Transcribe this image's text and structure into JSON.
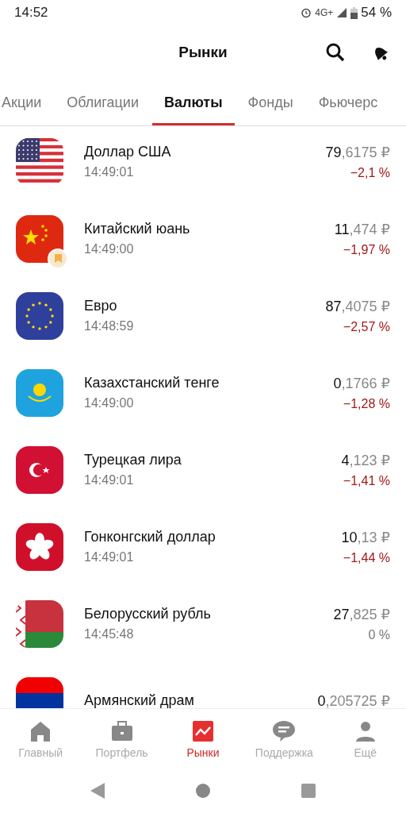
{
  "status_bar": {
    "time": "14:52",
    "network": "4G+",
    "battery": "54 %"
  },
  "header": {
    "title": "Рынки"
  },
  "tabs": [
    {
      "label": "Акции",
      "selected": false
    },
    {
      "label": "Облигации",
      "selected": false
    },
    {
      "label": "Валюты",
      "selected": true
    },
    {
      "label": "Фонды",
      "selected": false
    },
    {
      "label": "Фьючерс",
      "selected": false
    }
  ],
  "currencies": [
    {
      "kind": "us",
      "name": "Доллар США",
      "time": "14:49:01",
      "price_whole": "79",
      "price_fraction": ",6175 ₽",
      "change": "−2,1 %",
      "color": "#a31818",
      "bookmarked": false
    },
    {
      "kind": "cn",
      "name": "Китайский юань",
      "time": "14:49:00",
      "price_whole": "11",
      "price_fraction": ",474 ₽",
      "change": "−1,97 %",
      "color": "#a31818",
      "bookmarked": true
    },
    {
      "kind": "eu",
      "name": "Евро",
      "time": "14:48:59",
      "price_whole": "87",
      "price_fraction": ",4075 ₽",
      "change": "−2,57 %",
      "color": "#a31818",
      "bookmarked": false
    },
    {
      "kind": "kz",
      "name": "Казахстанский тенге",
      "time": "14:49:00",
      "price_whole": "0",
      "price_fraction": ",1766 ₽",
      "change": "−1,28 %",
      "color": "#a31818",
      "bookmarked": false
    },
    {
      "kind": "tr",
      "name": "Турецкая лира",
      "time": "14:49:01",
      "price_whole": "4",
      "price_fraction": ",123 ₽",
      "change": "−1,41 %",
      "color": "#a31818",
      "bookmarked": false
    },
    {
      "kind": "hk",
      "name": "Гонконгский доллар",
      "time": "14:49:01",
      "price_whole": "10",
      "price_fraction": ",13 ₽",
      "change": "−1,44 %",
      "color": "#a31818",
      "bookmarked": false
    },
    {
      "kind": "by",
      "name": "Белорусский рубль",
      "time": "14:45:48",
      "price_whole": "27",
      "price_fraction": ",825 ₽",
      "change": "0 %",
      "color": "#777777",
      "bookmarked": false
    },
    {
      "kind": "am",
      "name": "Армянский драм",
      "price_whole": "0",
      "price_fraction": ",205725 ₽"
    }
  ],
  "bottom_nav": [
    {
      "kind": "home",
      "label": "Главный",
      "selected": false
    },
    {
      "kind": "briefcase",
      "label": "Портфель",
      "selected": false
    },
    {
      "kind": "chart",
      "label": "Рынки",
      "selected": true
    },
    {
      "kind": "chat",
      "label": "Поддержка",
      "selected": false
    },
    {
      "kind": "person",
      "label": "Ещё",
      "selected": false
    }
  ]
}
